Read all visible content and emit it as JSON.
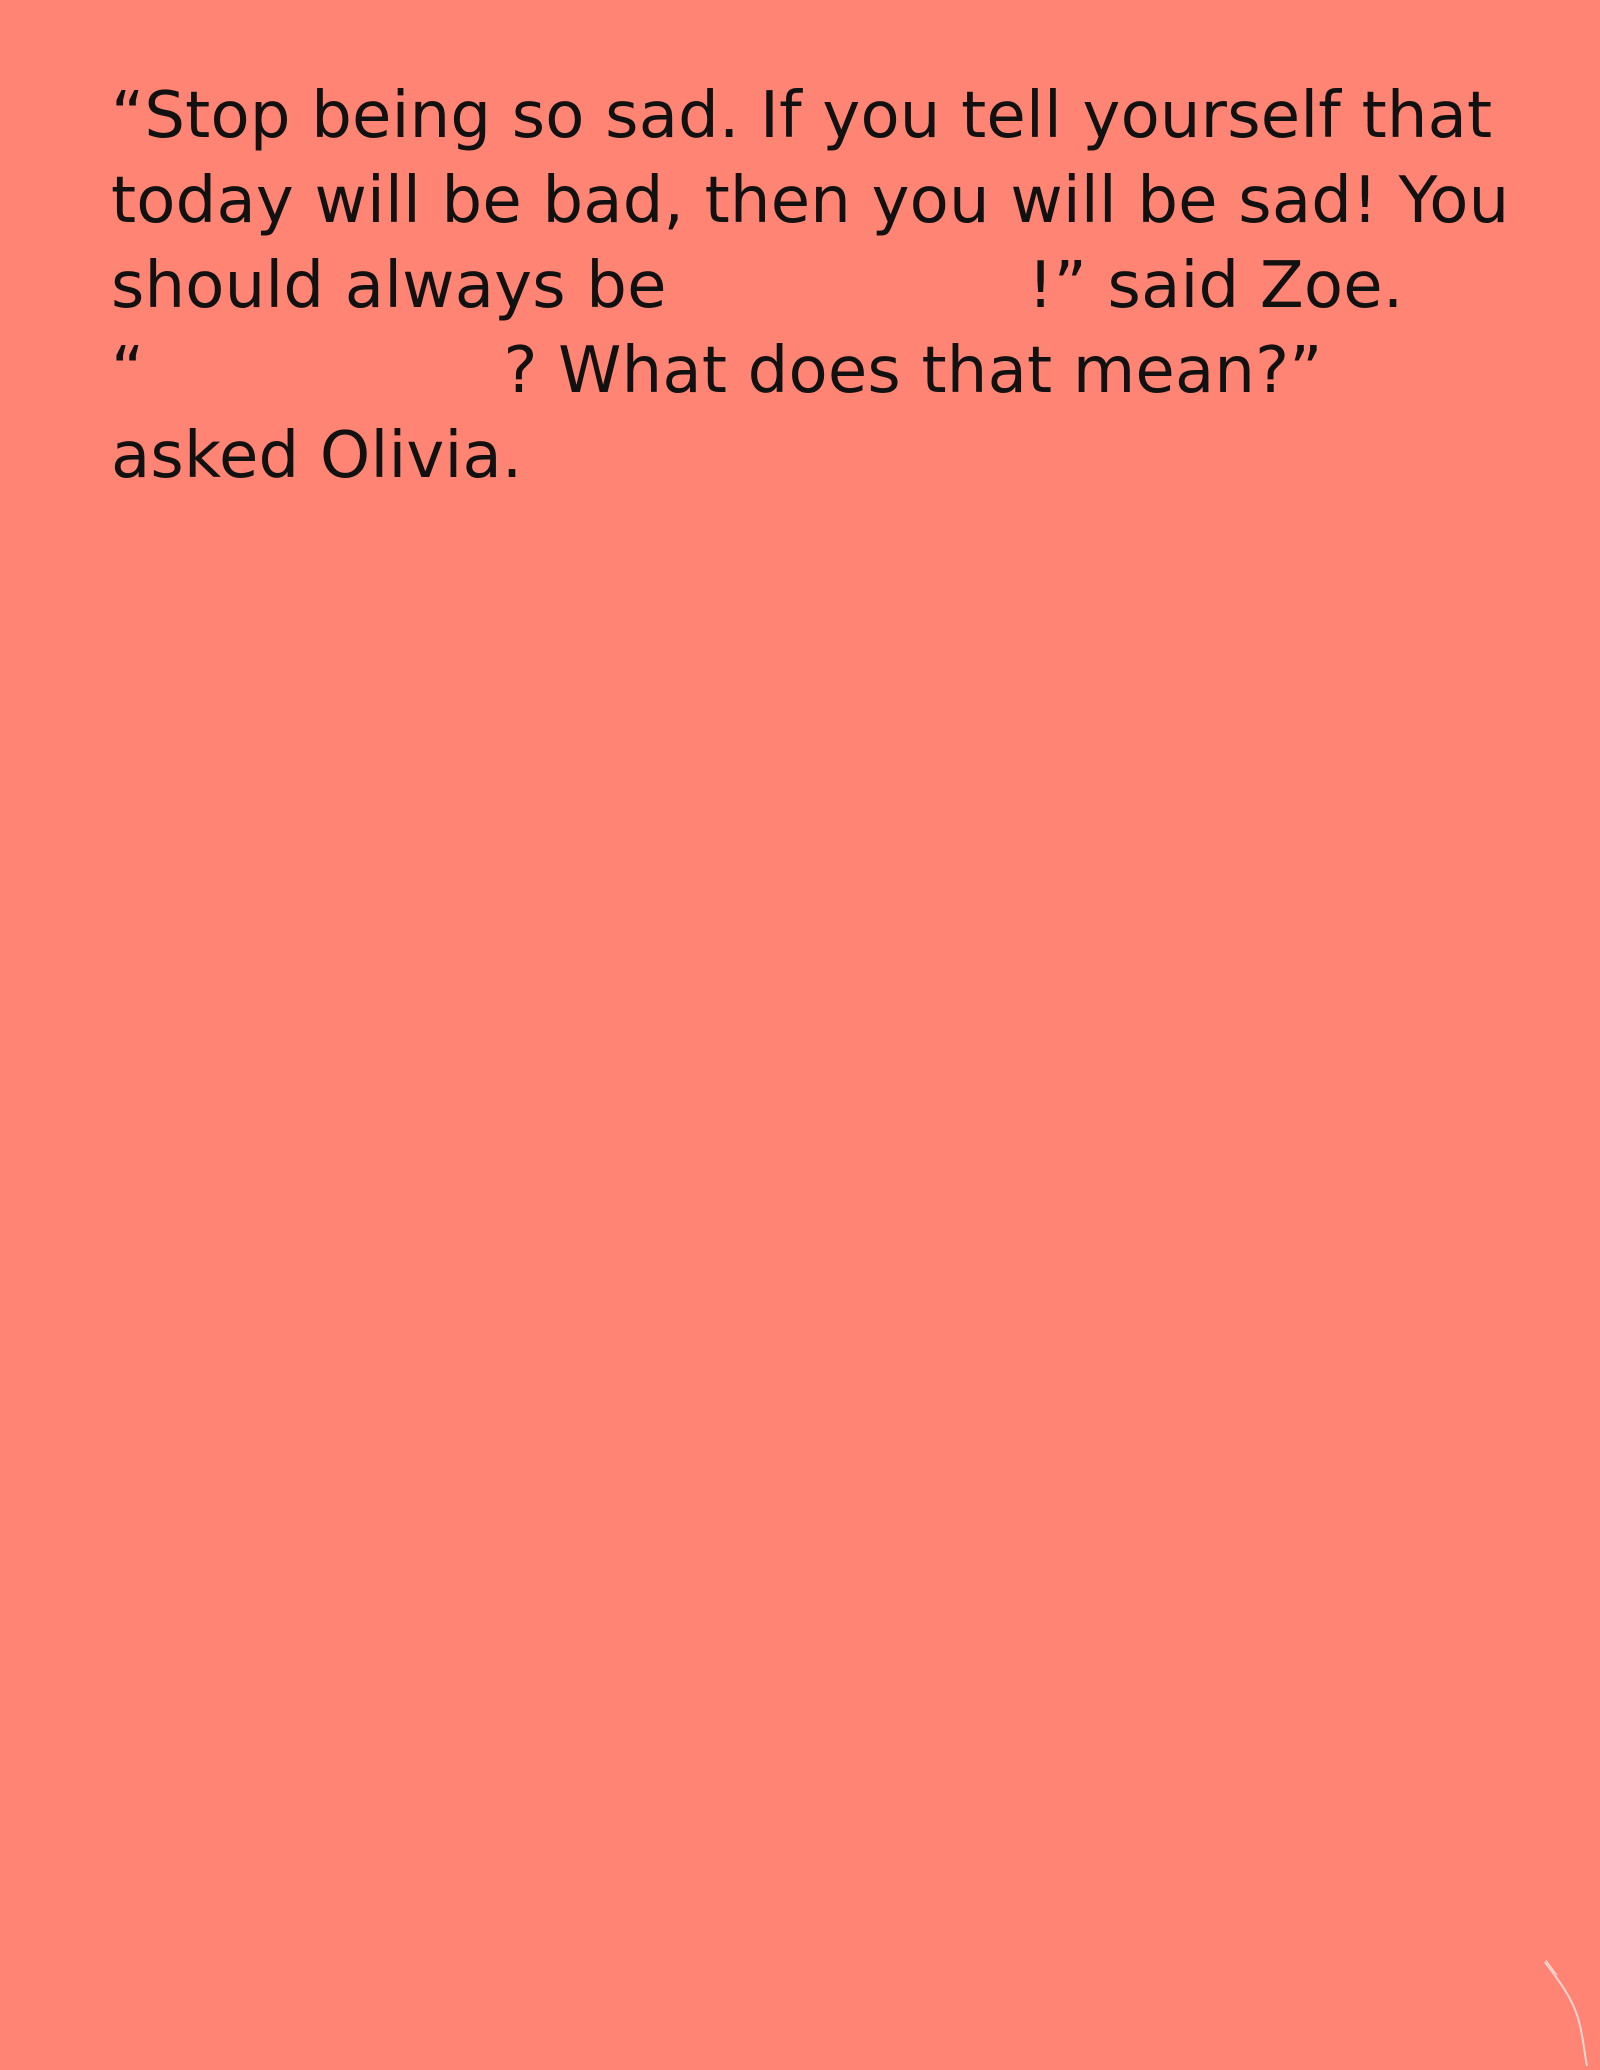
{
  "story": {
    "line1": "“Stop being so sad. If you tell yourself that",
    "line2": "today will be bad, then you will be sad! You",
    "line3_before": "should always be",
    "line3_after": "!” said Zoe.",
    "line4_before": "“",
    "line4_after": "? What does that mean?”",
    "line5": "asked Olivia."
  },
  "colors": {
    "background": "#ff8474",
    "text": "#111111"
  }
}
